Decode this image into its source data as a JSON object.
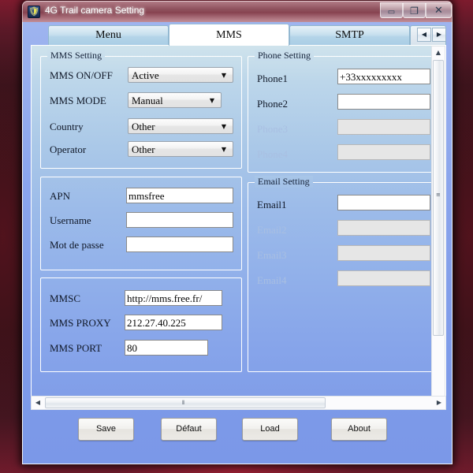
{
  "window": {
    "title": "4G Trail camera Setting",
    "icon": "camera-app-icon",
    "buttons": {
      "minimize": "minimize-icon",
      "minimize_glyph": "▭",
      "maximize": "maximize-icon",
      "maximize_glyph": "❐",
      "close": "close-icon",
      "close_glyph": "✕"
    }
  },
  "tabs": {
    "items": [
      {
        "label": "Menu",
        "active": false
      },
      {
        "label": "MMS",
        "active": true
      },
      {
        "label": "SMTP",
        "active": false
      }
    ],
    "nav_prev": "◀",
    "nav_next": "▶"
  },
  "mms_setting": {
    "legend": "MMS Setting",
    "fields": [
      {
        "label": "MMS ON/OFF",
        "value": "Active",
        "type": "combo",
        "enabled": true
      },
      {
        "label": "MMS MODE",
        "value": "Manual",
        "type": "combo",
        "enabled": true
      },
      {
        "label": "Country",
        "value": "Other",
        "type": "combo",
        "enabled": true
      },
      {
        "label": "Operator",
        "value": "Other",
        "type": "combo",
        "enabled": true
      }
    ],
    "combo_arrow": "▼"
  },
  "apn_setting": {
    "legend": "",
    "fields": [
      {
        "label": "APN",
        "value": "mmsfree",
        "type": "text",
        "enabled": true
      },
      {
        "label": "Username",
        "value": "",
        "type": "text",
        "enabled": true
      },
      {
        "label": "Mot de passe",
        "value": "",
        "type": "text",
        "enabled": true
      }
    ]
  },
  "mmsc_setting": {
    "legend": "",
    "fields": [
      {
        "label": "MMS PROXY",
        "value": "212.27.40.225",
        "type": "text",
        "enabled": true
      },
      {
        "label": "MMSC",
        "value": "http://mms.free.fr/",
        "type": "text",
        "enabled": true
      },
      {
        "label": "MMS PORT",
        "value": "80",
        "type": "text",
        "enabled": true
      }
    ]
  },
  "phone_setting": {
    "legend": "Phone Setting",
    "fields": [
      {
        "label": "Phone1",
        "value": "+33xxxxxxxxx",
        "type": "text",
        "enabled": true
      },
      {
        "label": "Phone2",
        "value": "",
        "type": "text",
        "enabled": true
      },
      {
        "label": "Phone3",
        "value": "",
        "type": "text",
        "enabled": false
      },
      {
        "label": "Phone4",
        "value": "",
        "type": "text",
        "enabled": false
      }
    ]
  },
  "email_setting": {
    "legend": "Email Setting",
    "fields": [
      {
        "label": "Email1",
        "value": "",
        "type": "text",
        "enabled": true
      },
      {
        "label": "Email2",
        "value": "",
        "type": "text",
        "enabled": false
      },
      {
        "label": "Email3",
        "value": "",
        "type": "text",
        "enabled": false
      },
      {
        "label": "Email4",
        "value": "",
        "type": "text",
        "enabled": false
      }
    ]
  },
  "scrollbars": {
    "vertical": {
      "up": "▲",
      "down": "▼",
      "grip": "≡"
    },
    "horizontal": {
      "left": "◀",
      "right": "▶",
      "grip": "⦀"
    }
  },
  "footer": {
    "buttons": [
      {
        "label": "Save"
      },
      {
        "label": "Défaut"
      },
      {
        "label": "Load"
      },
      {
        "label": "About"
      }
    ]
  },
  "colors": {
    "client_background": "#8ba5ec",
    "panel_top": "#cfe3ec",
    "panel_bottom": "#7f9ce8",
    "titlebar": "#8e4150",
    "active_tab": "#ffffff",
    "inactive_tab": "#b4d4e8",
    "disabled_field": "#e6e6e6"
  }
}
